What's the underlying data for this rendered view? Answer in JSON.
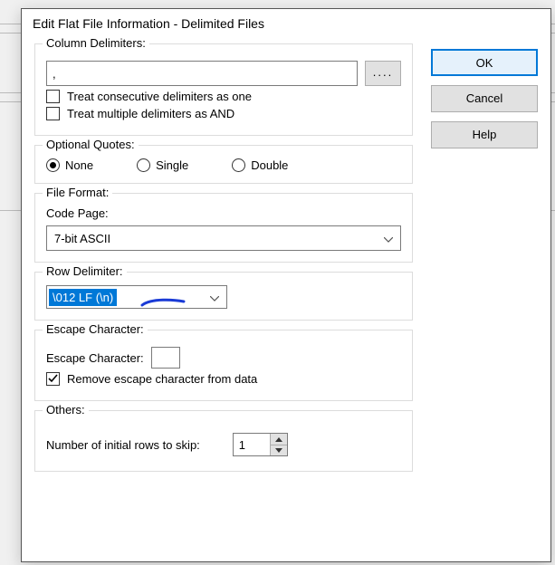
{
  "title": "Edit Flat File Information - Delimited Files",
  "buttons": {
    "ok": "OK",
    "cancel": "Cancel",
    "help": "Help",
    "dots": "...."
  },
  "column_delimiters": {
    "legend": "Column Delimiters:",
    "value": ",",
    "treat_consecutive": {
      "label": "Treat consecutive delimiters as one",
      "checked": false
    },
    "treat_and": {
      "label": "Treat multiple delimiters as AND",
      "checked": false
    }
  },
  "optional_quotes": {
    "legend": "Optional Quotes:",
    "options": {
      "none": "None",
      "single": "Single",
      "double": "Double"
    },
    "selected": "none"
  },
  "file_format": {
    "legend": "File Format:",
    "code_page_label": "Code Page:",
    "code_page_value": "7-bit ASCII"
  },
  "row_delimiter": {
    "legend": "Row Delimiter:",
    "value": "\\012  LF  (\\n)"
  },
  "escape": {
    "legend": "Escape Character:",
    "field_label": "Escape Character:",
    "value": "",
    "remove": {
      "label": "Remove escape character from data",
      "checked": true
    }
  },
  "others": {
    "legend": "Others:",
    "skip_label": "Number of initial rows to skip:",
    "skip_value": "1"
  }
}
